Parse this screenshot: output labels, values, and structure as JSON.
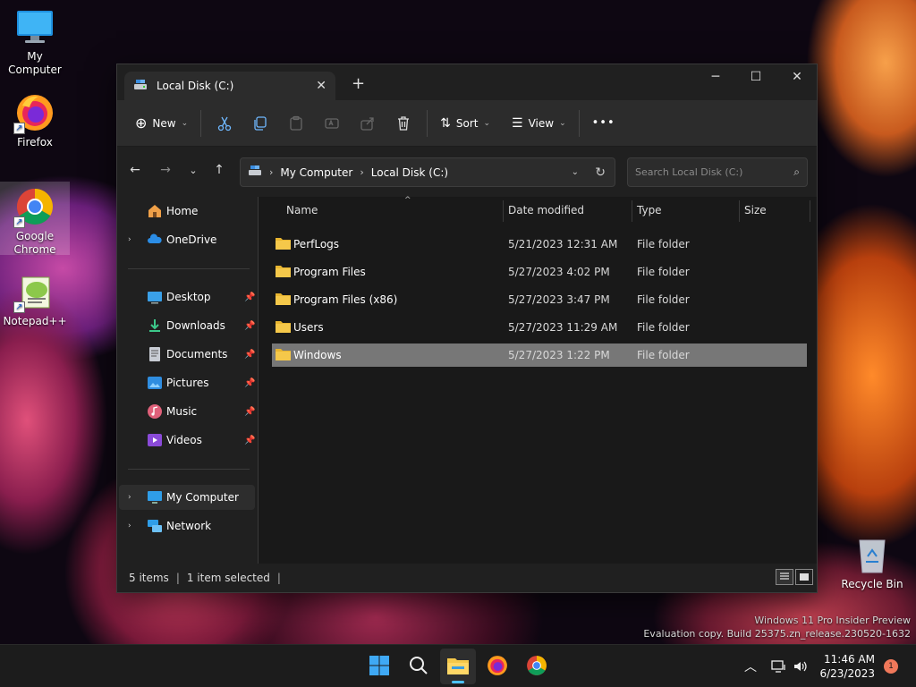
{
  "desktop": {
    "icons": [
      {
        "label": "My Computer",
        "icon": "monitor-icon"
      },
      {
        "label": "Firefox",
        "icon": "firefox-icon"
      },
      {
        "label": "Google Chrome",
        "icon": "chrome-icon"
      },
      {
        "label": "Notepad++",
        "icon": "notepadpp-icon"
      }
    ],
    "recycle_bin": "Recycle Bin",
    "watermark": {
      "line1": "Windows 11 Pro Insider Preview",
      "line2": "Evaluation copy. Build 25375.zn_release.230520-1632"
    }
  },
  "window": {
    "tab_title": "Local Disk (C:)",
    "toolbar": {
      "new_label": "New",
      "sort_label": "Sort",
      "view_label": "View",
      "more_label": "•••"
    },
    "address": {
      "crumbs": [
        "My Computer",
        "Local Disk (C:)"
      ],
      "search_placeholder": "Search Local Disk (C:)"
    },
    "sidebar": {
      "home": "Home",
      "onedrive": "OneDrive",
      "quick": [
        "Desktop",
        "Downloads",
        "Documents",
        "Pictures",
        "Music",
        "Videos"
      ],
      "my_computer": "My Computer",
      "network": "Network"
    },
    "columns": {
      "name": "Name",
      "date": "Date modified",
      "type": "Type",
      "size": "Size"
    },
    "files": [
      {
        "name": "PerfLogs",
        "date": "5/21/2023 12:31 AM",
        "type": "File folder",
        "size": ""
      },
      {
        "name": "Program Files",
        "date": "5/27/2023 4:02 PM",
        "type": "File folder",
        "size": ""
      },
      {
        "name": "Program Files (x86)",
        "date": "5/27/2023 3:47 PM",
        "type": "File folder",
        "size": ""
      },
      {
        "name": "Users",
        "date": "5/27/2023 11:29 AM",
        "type": "File folder",
        "size": ""
      },
      {
        "name": "Windows",
        "date": "5/27/2023 1:22 PM",
        "type": "File folder",
        "size": ""
      }
    ],
    "selected_file": "Windows",
    "status": {
      "count": "5 items",
      "selection": "1 item selected"
    }
  },
  "taskbar": {
    "time": "11:46 AM",
    "date": "6/23/2023",
    "notifications": "1"
  },
  "colors": {
    "folder": "#f5c84a",
    "accent": "#4cc2ff",
    "selection": "#777777"
  }
}
